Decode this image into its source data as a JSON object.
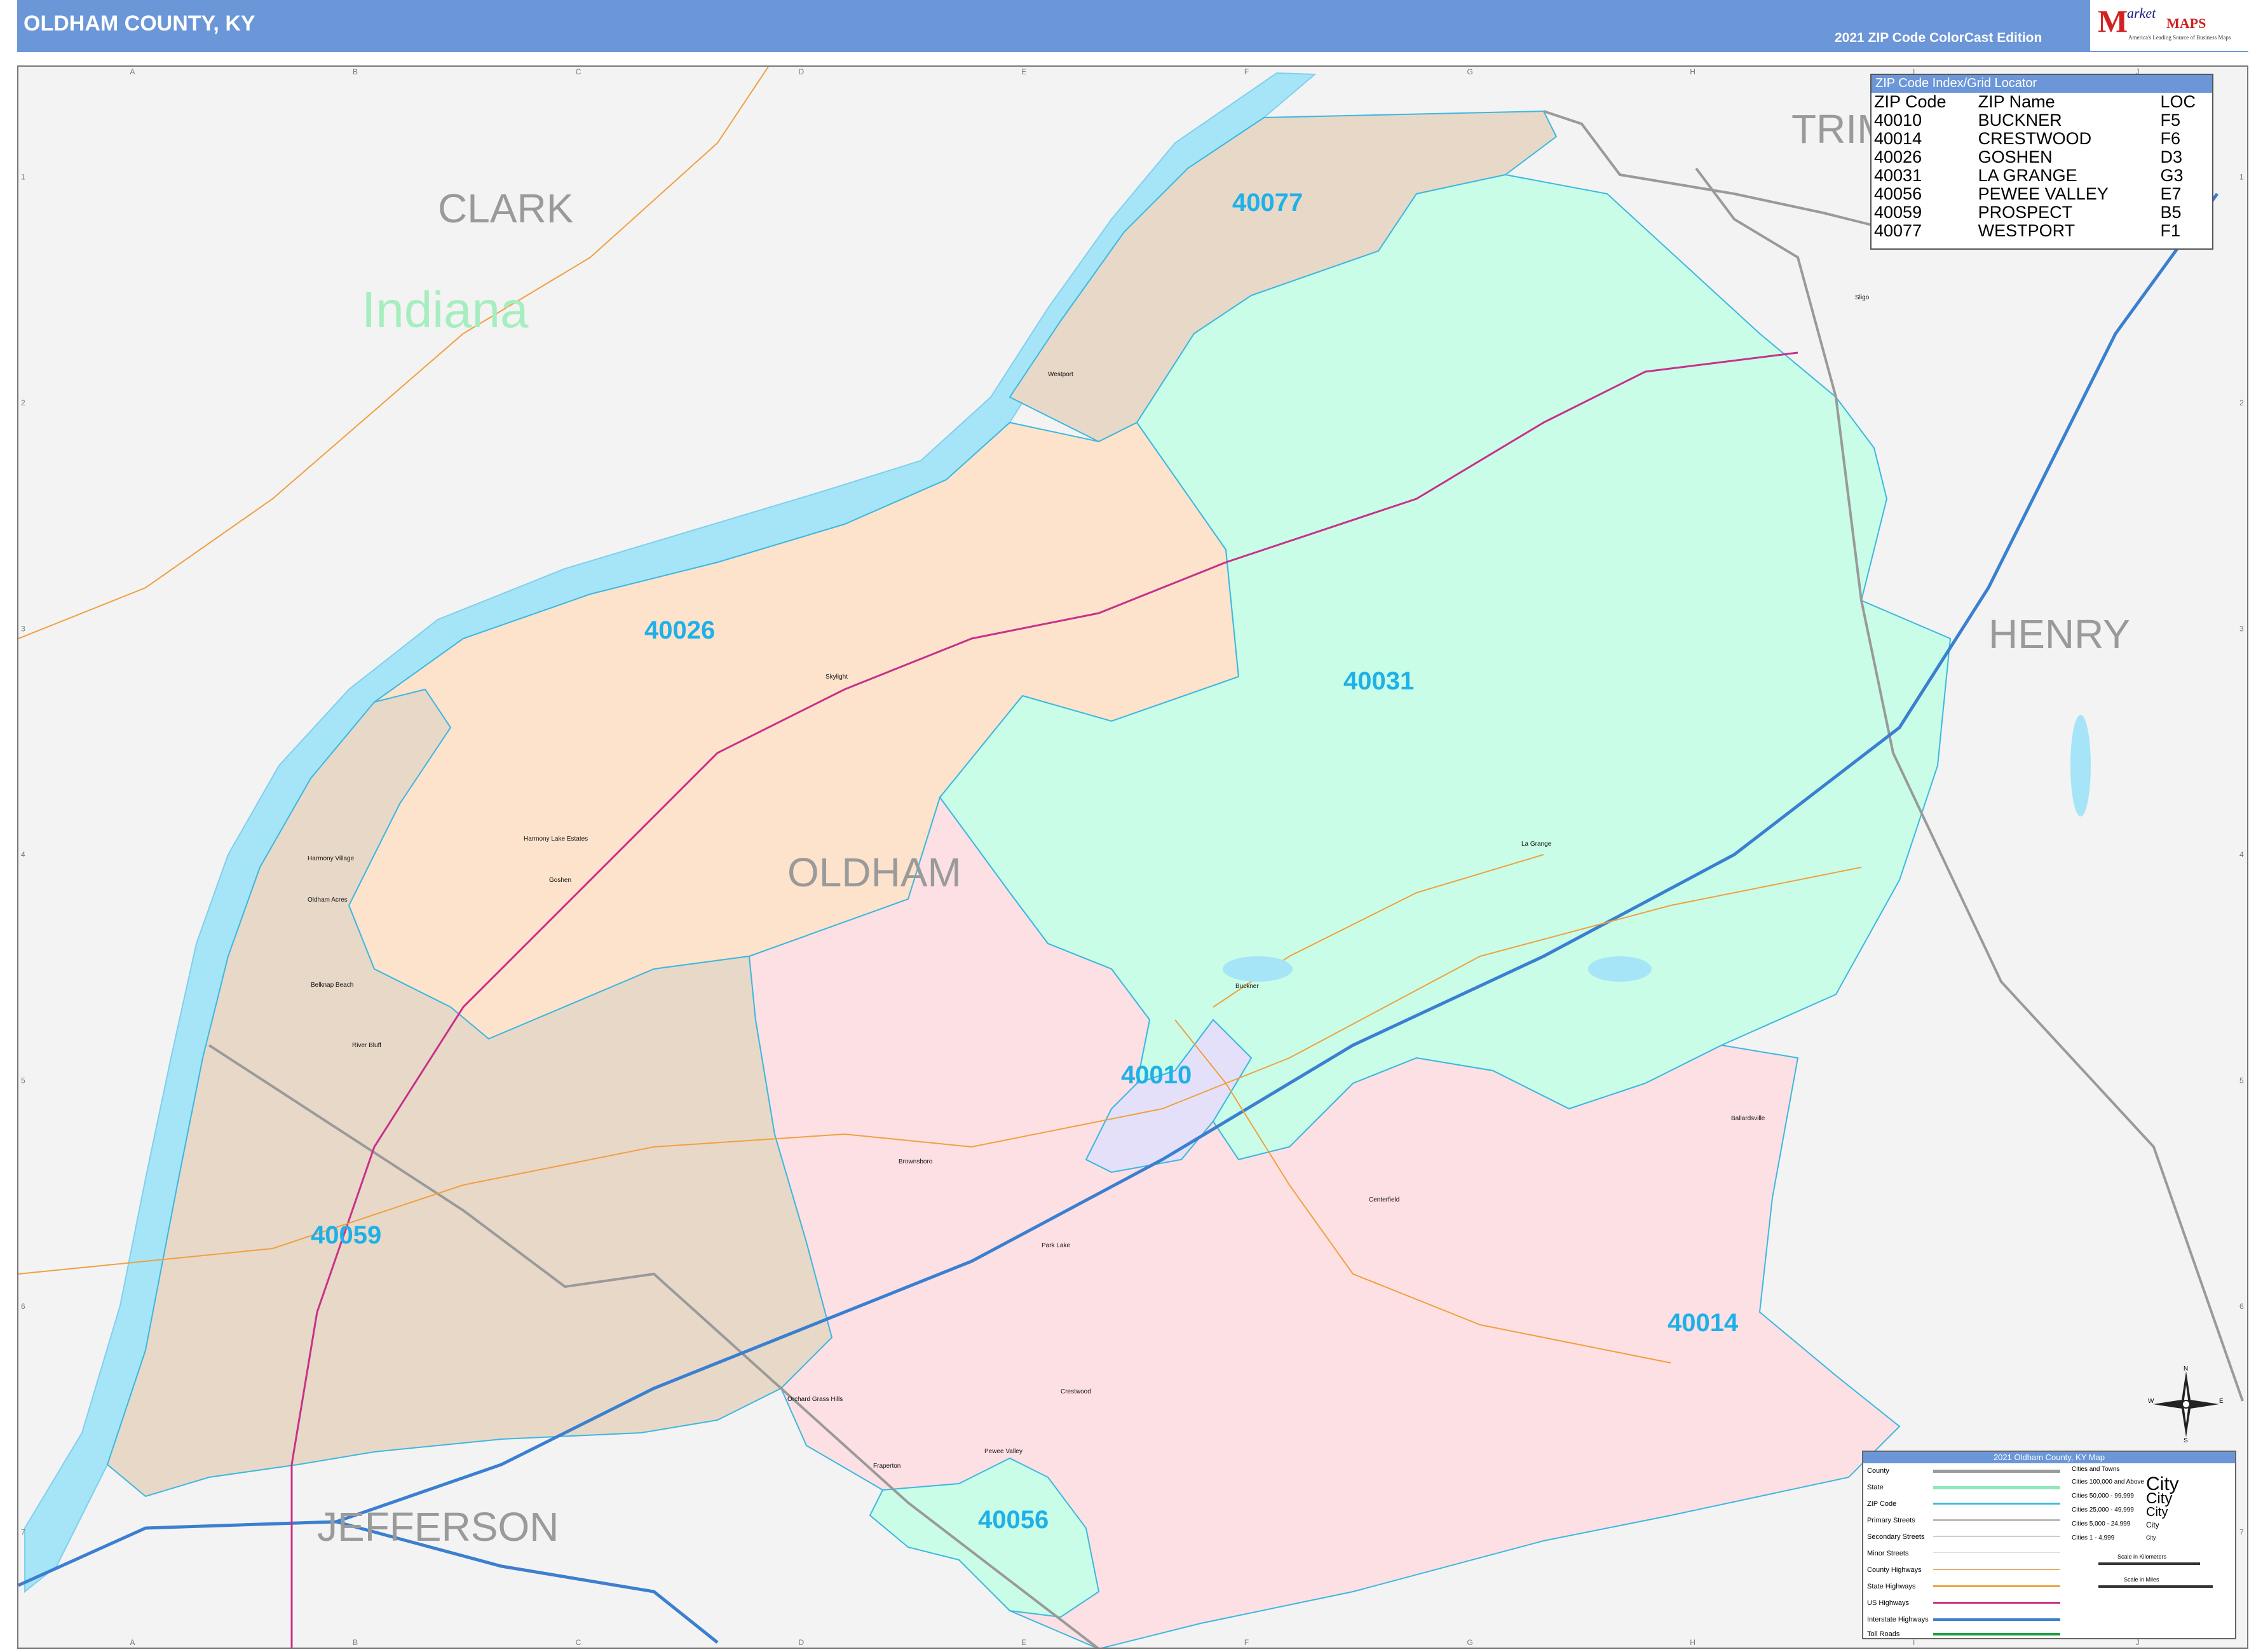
{
  "header": {
    "title": "OLDHAM COUNTY, KY",
    "edition": "2021 ZIP Code ColorCast Edition",
    "logo": {
      "m": "M",
      "market": "arket",
      "maps": "MAPS",
      "tagline": "America's Leading Source of Business Maps"
    }
  },
  "map": {
    "grid_cols": [
      "A",
      "B",
      "C",
      "D",
      "E",
      "F",
      "G",
      "H",
      "I",
      "J"
    ],
    "grid_rows": [
      "1",
      "2",
      "3",
      "4",
      "5",
      "6",
      "7"
    ],
    "state_label": "Indiana",
    "county_labels": {
      "clark": "CLARK",
      "trimble": "TRIM",
      "henry": "HENRY",
      "oldham": "OLDHAM",
      "jefferson": "JEFFERSON"
    },
    "zip_labels": {
      "z40077": "40077",
      "z40026": "40026",
      "z40031": "40031",
      "z40010": "40010",
      "z40059": "40059",
      "z40014": "40014",
      "z40056": "40056"
    },
    "places": {
      "westport": "Westport",
      "skylight": "Skylight",
      "harmony_lake": "Harmony Lake Estates",
      "goshen": "Goshen",
      "harmony_village": "Harmony Village",
      "oldham_acres": "Oldham Acres",
      "belknap_beach": "Belknap Beach",
      "river_bluff": "River Bluff",
      "la_grange": "La Grange",
      "buckner": "Buckner",
      "brownsboro": "Brownsboro",
      "park_lake": "Park Lake",
      "centerfield": "Centerfield",
      "ballardsville": "Ballardsville",
      "oldham_grass_hills": "Orchard Grass Hills",
      "crestwood": "Crestwood",
      "fraperton": "Fraperton",
      "pewee_valley": "Pewee Valley",
      "sligo": "Sligo"
    },
    "colors": {
      "river": "#a6e4f8",
      "outside": "#f3f3f3",
      "z40077": "#e8d8c8",
      "z40026": "#fde3cc",
      "z40031": "#c9fde7",
      "z40010": "#e4e0fa",
      "z40059": "#e8d8c8",
      "z40014": "#fde0e4",
      "z40056": "#c9fde7",
      "zip_border": "#3cb8e0",
      "interstate": "#3b7fd0",
      "us_highway": "#c8318a",
      "state_highway": "#f0a040",
      "county_line": "#9a9a9a"
    }
  },
  "zip_index": {
    "title": "ZIP Code Index/Grid Locator",
    "headers": [
      "ZIP Code",
      "ZIP Name",
      "LOC"
    ],
    "rows": [
      [
        "40010",
        "BUCKNER",
        "F5"
      ],
      [
        "40014",
        "CRESTWOOD",
        "F6"
      ],
      [
        "40026",
        "GOSHEN",
        "D3"
      ],
      [
        "40031",
        "LA GRANGE",
        "G3"
      ],
      [
        "40056",
        "PEWEE VALLEY",
        "E7"
      ],
      [
        "40059",
        "PROSPECT",
        "B5"
      ],
      [
        "40077",
        "WESTPORT",
        "F1"
      ]
    ]
  },
  "legend": {
    "title": "2021 Oldham County, KY Map",
    "rows": [
      "County",
      "State",
      "ZIP Code",
      "Primary Streets",
      "Secondary Streets",
      "Minor Streets",
      "County Highways",
      "State Highways",
      "US Highways",
      "Interstate Highways",
      "Toll Roads"
    ],
    "cities_header": "Cities and Towns",
    "cities": [
      "Cities 100,000 and Above",
      "Cities 50,000 - 99,999",
      "Cities 25,000 - 49,999",
      "Cities 5,000 - 24,999",
      "Cities 1 - 4,999"
    ],
    "city_sample": "City",
    "scale_km": "Scale in Kilometers",
    "scale_mi": "Scale in Miles"
  },
  "compass": {
    "n": "N",
    "s": "S",
    "e": "E",
    "w": "W"
  }
}
